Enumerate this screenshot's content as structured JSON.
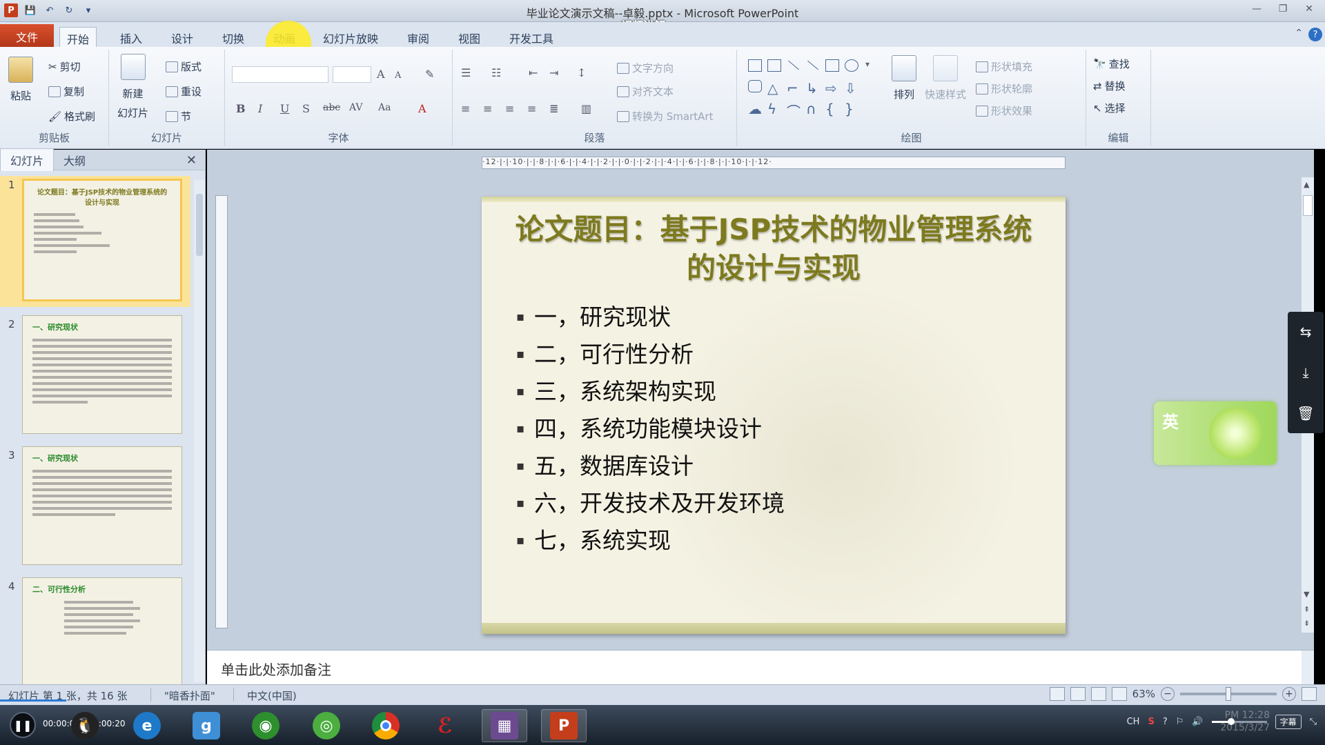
{
  "window": {
    "title": "毕业论文演示文稿--卓毅.pptx - Microsoft PowerPoint",
    "video_name": "视频讲解.wmv",
    "app_icon_letter": "P"
  },
  "tabs": {
    "file": "文件",
    "items": [
      "开始",
      "插入",
      "设计",
      "切换",
      "动画",
      "幻灯片放映",
      "审阅",
      "视图",
      "开发工具"
    ],
    "active": "开始"
  },
  "ribbon": {
    "clipboard": {
      "paste": "粘贴",
      "cut": "剪切",
      "copy": "复制",
      "format_painter": "格式刷",
      "label": "剪贴板"
    },
    "slides": {
      "new_slide_line1": "新建",
      "new_slide_line2": "幻灯片",
      "layout": "版式",
      "reset": "重设",
      "section": "节",
      "label": "幻灯片"
    },
    "font": {
      "label": "字体",
      "bold": "B",
      "italic": "I",
      "underline": "U",
      "shadow": "S",
      "strike": "abc",
      "spacing": "AV",
      "case": "Aa",
      "color": "A",
      "grow": "A",
      "shrink": "A"
    },
    "paragraph": {
      "text_direction": "文字方向",
      "align_text": "对齐文本",
      "smartart": "转换为 SmartArt",
      "label": "段落"
    },
    "drawing": {
      "arrange": "排列",
      "quick_styles": "快速样式",
      "shape_fill": "形状填充",
      "shape_outline": "形状轮廓",
      "shape_effects": "形状效果",
      "label": "绘图"
    },
    "editing": {
      "find": "查找",
      "replace": "替换",
      "select": "选择",
      "label": "编辑"
    }
  },
  "left_pane": {
    "tabs": [
      "幻灯片",
      "大纲"
    ],
    "close": "✕",
    "thumbnails": [
      {
        "num": "1",
        "title": "论文题目：基于JSP技术的物业管理系统的设计与实现",
        "lines": 7
      },
      {
        "num": "2",
        "title": "一、研究现状",
        "lines": 11
      },
      {
        "num": "3",
        "title": "一、研究现状",
        "lines": 8
      },
      {
        "num": "4",
        "title": "二、可行性分析",
        "lines": 6
      }
    ]
  },
  "slide": {
    "title": "论文题目：基于JSP技术的物业管理系统的设计与实现",
    "bullet": "▪",
    "items": [
      "一，研究现状",
      "二，可行性分析",
      "三，系统架构实现",
      "四，系统功能模块设计",
      "五，数据库设计",
      "六，开发技术及开发环境",
      "七，系统实现"
    ]
  },
  "ruler": {
    "h_marks": "·12·|·|·10·|·|·8·|·|·6·|·|·4·|·|·2·|·|·0·|·|·2·|·|·4·|·|·6·|·|·8·|·|·10·|·|·12·"
  },
  "notes": {
    "placeholder": "单击此处添加备注"
  },
  "status": {
    "slide_info": "幻灯片 第 1 张，共 16 张",
    "theme": "\"暗香扑面\"",
    "language": "中文(中国)",
    "zoom": "63%",
    "zoom_minus": "−",
    "zoom_plus": "+",
    "zoom_fraction": 0.5
  },
  "player": {
    "play_icon": "❚❚",
    "time": "00:00:01 / 00:00:20",
    "subtitle_btn": "字幕",
    "tray_text": "CH",
    "volume": 0.35,
    "clock_time": "PM 12:28",
    "clock_date": "2015/3/27"
  },
  "ime": {
    "label": "英"
  },
  "colors": {
    "file_tab": "#c43e1c",
    "slide_title": "#7d7a1f",
    "slide_bg": "#f4f2e3",
    "taskbar": "#1f2a36"
  }
}
